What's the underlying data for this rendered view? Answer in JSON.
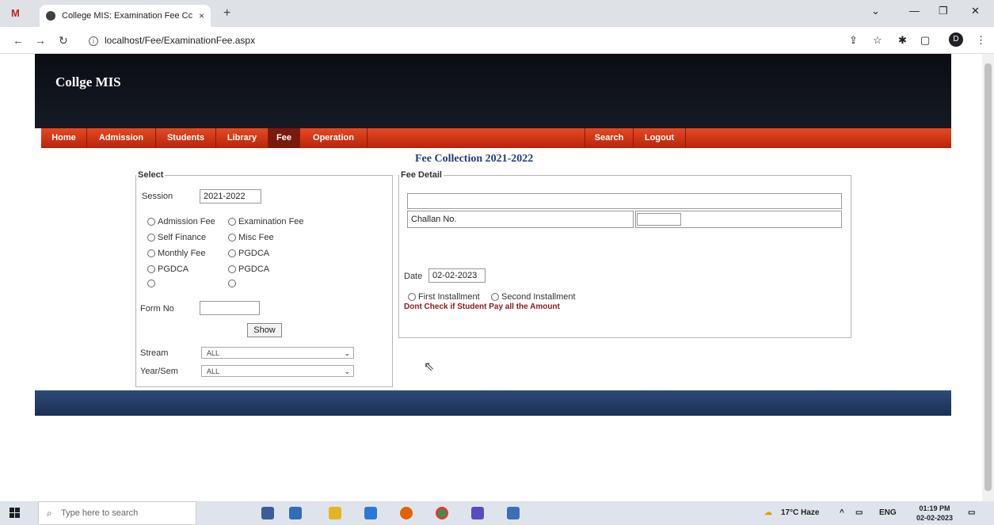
{
  "browser": {
    "gmail_tab": "M",
    "tab_title": "College MIS: Examination Fee Cc",
    "tab_close": "×",
    "new_tab": "+",
    "url": "localhost/Fee/ExaminationFee.aspx",
    "profile_initial": "D"
  },
  "site": {
    "brand": "Collge MIS",
    "menu_left": [
      "Home",
      "Admission",
      "Students",
      "Library",
      "Fee",
      "Operation"
    ],
    "menu_right": [
      "Search",
      "Logout"
    ],
    "active_menu": "Fee",
    "page_title": "Fee Collection 2021-2022"
  },
  "select_panel": {
    "legend": "Select",
    "session_label": "Session",
    "session_value": "2021-2022",
    "radios": [
      "Admission Fee",
      "Examination Fee",
      "Self Finance",
      "Misc Fee",
      "Monthly Fee",
      "PGDCA",
      "PGDCA",
      "PGDCA",
      "",
      ""
    ],
    "form_no_label": "Form No",
    "form_no_value": "",
    "show_button": "Show",
    "stream_label": "Stream",
    "stream_value": "ALL",
    "yearsem_label": "Year/Sem",
    "yearsem_value": "ALL"
  },
  "fee_detail": {
    "legend": "Fee Detail",
    "challan_label": "Challan No.",
    "challan_value": "",
    "date_label": "Date",
    "date_value": "02-02-2023",
    "installment_radios": [
      "First Installment",
      "Second Installment"
    ],
    "warning": "Dont Check if Student Pay all the Amount"
  },
  "taskbar": {
    "search_placeholder": "Type here to search",
    "weather": "17°C Haze",
    "language": "ENG",
    "time": "01:19 PM",
    "date": "02-02-2023"
  },
  "colors": {
    "header": "#0b0d13",
    "menubar": "#d23a17",
    "title": "#1f3d7a",
    "footer": "#2d4a78",
    "warning": "#8b1a1a"
  }
}
